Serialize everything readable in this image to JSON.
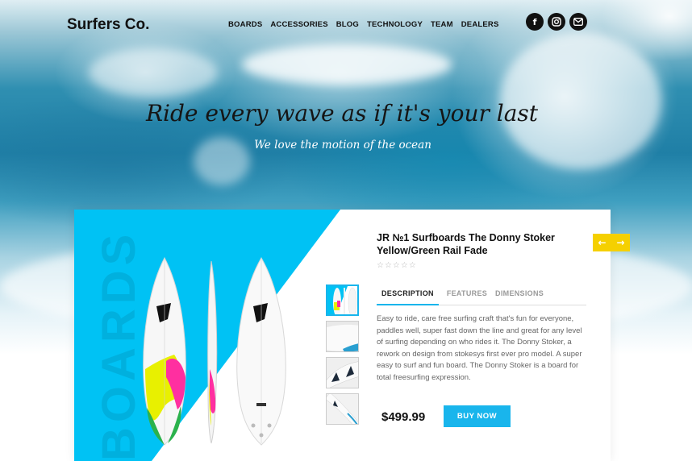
{
  "header": {
    "logo": "Surfers Co.",
    "nav": [
      "BOARDS",
      "ACCESSORIES",
      "BLOG",
      "TECHNOLOGY",
      "TEAM",
      "DEALERS"
    ],
    "social": [
      {
        "icon": "facebook-icon",
        "glyph": "f"
      },
      {
        "icon": "instagram-icon",
        "glyph": "◎"
      },
      {
        "icon": "mail-icon",
        "glyph": "✉"
      }
    ]
  },
  "hero": {
    "tagline": "Ride every wave as if it's your last",
    "subtagline": "We love the motion of the ocean"
  },
  "product": {
    "category_watermark": "BOARDS",
    "title": "JR №1 Surfboards The Donny Stoker Yellow/Green Rail Fade",
    "rating": "☆☆☆☆☆",
    "tabs": [
      "DESCRIPTION",
      "FEATURES",
      "DIMENSIONS"
    ],
    "active_tab": "DESCRIPTION",
    "description": "Easy to ride, care free surfing craft that's fun for everyone, paddles well, super fast down the line and great for any level of surfing depending on who rides it. The Donny Stoker, a rework on design from stokesys first ever pro model. A super easy to surf and fun board. The Donny Stoker is a board for total freesurfing expression.",
    "price": "$499.99",
    "buy_label": "BUY NOW"
  },
  "carousel": {
    "prev_icon": "arrow-left-icon",
    "next_icon": "arrow-right-icon",
    "prev_glyph": "←",
    "next_glyph": "→"
  },
  "colors": {
    "accent_blue": "#19b5ec",
    "card_blue": "#00c2f4",
    "arrow_yellow": "#f5d000",
    "board_yellow": "#e8f000",
    "board_pink": "#ff2fa0",
    "board_green": "#2bb24c"
  }
}
